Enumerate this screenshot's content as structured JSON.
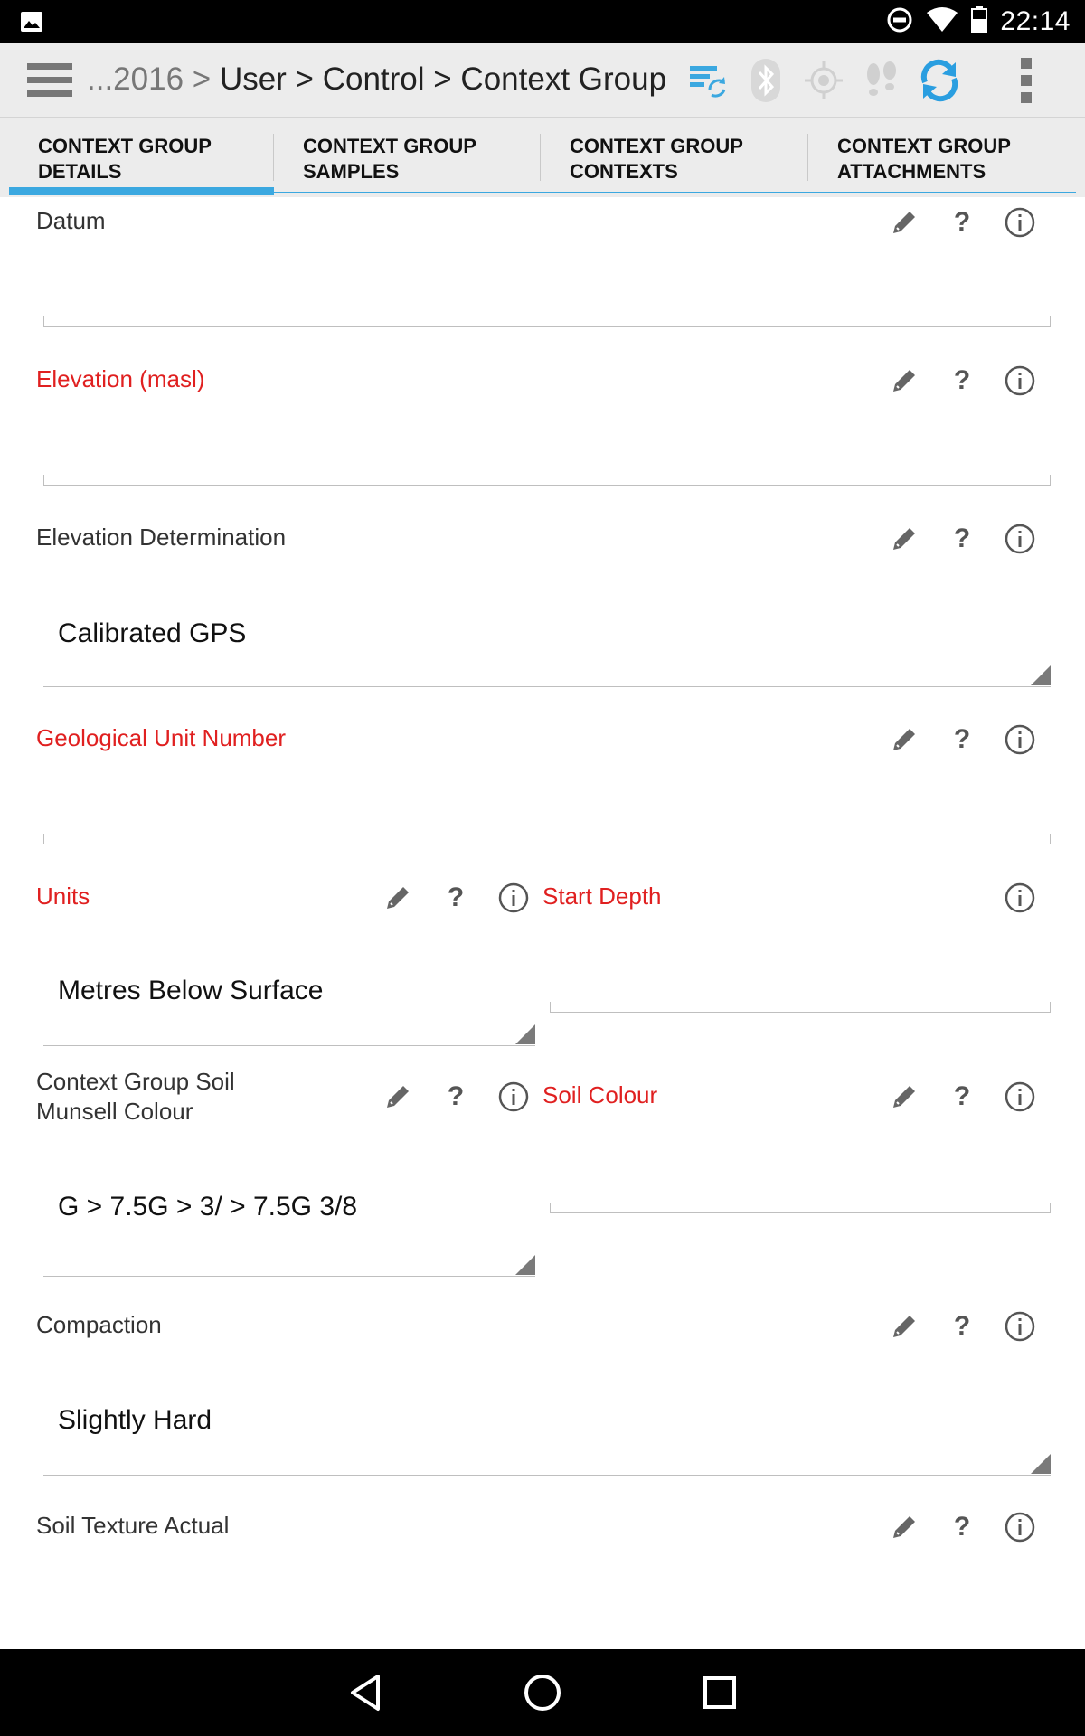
{
  "status_bar": {
    "time": "22:14",
    "icons": [
      "gallery-icon",
      "do-not-disturb-icon",
      "wifi-icon",
      "battery-icon"
    ]
  },
  "app_bar": {
    "breadcrumb_prefix": "...2016 >",
    "breadcrumb_path": "User > Control > Context Group",
    "tools": [
      "sync-settings-icon",
      "bluetooth-icon",
      "gps-icon",
      "footsteps-icon",
      "refresh-icon",
      "overflow-menu-icon"
    ]
  },
  "tabs": [
    {
      "line1": "Context Group",
      "line2": "Details",
      "active": true
    },
    {
      "line1": "Context Group",
      "line2": "Samples",
      "active": false
    },
    {
      "line1": "Context Group",
      "line2": "Contexts",
      "active": false
    },
    {
      "line1": "Context Group",
      "line2": "Attachments",
      "active": false
    }
  ],
  "fields": {
    "datum": {
      "label": "Datum",
      "value": ""
    },
    "elevation": {
      "label": "Elevation (masl)",
      "value": ""
    },
    "elevation_determination": {
      "label": "Elevation Determination",
      "value": "Calibrated GPS"
    },
    "geological_unit_number": {
      "label": "Geological Unit Number",
      "value": ""
    },
    "units": {
      "label": "Units",
      "value": "Metres Below Surface"
    },
    "start_depth": {
      "label": "Start Depth",
      "value": ""
    },
    "munsell_colour": {
      "label_line1": "Context Group Soil",
      "label_line2": "Munsell Colour",
      "value": "G > 7.5G > 3/ > 7.5G 3/8"
    },
    "soil_colour": {
      "label": "Soil Colour",
      "value": ""
    },
    "compaction": {
      "label": "Compaction",
      "value": "Slightly Hard"
    },
    "soil_texture_actual": {
      "label": "Soil Texture Actual"
    }
  },
  "field_icons": {
    "edit": "pencil-icon",
    "help": "?",
    "info": "info-icon"
  },
  "colors": {
    "required_label": "#e02020",
    "tab_indicator": "#3ba8e0",
    "refresh_accent": "#2a9ee0"
  },
  "nav_bar": [
    "back-icon",
    "home-icon",
    "recents-icon"
  ]
}
